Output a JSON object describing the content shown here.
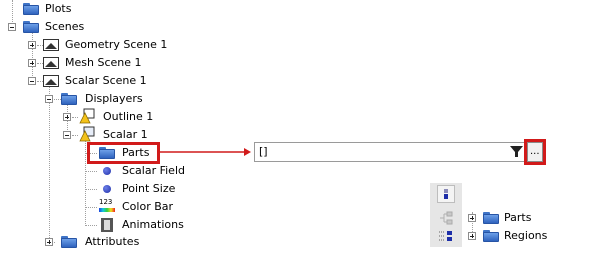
{
  "tree": {
    "plots": "Plots",
    "scenes": "Scenes",
    "geometry_scene": "Geometry Scene 1",
    "mesh_scene": "Mesh Scene 1",
    "scalar_scene": "Scalar Scene 1",
    "displayers": "Displayers",
    "outline": "Outline 1",
    "scalar": "Scalar 1",
    "parts": "Parts",
    "scalar_field": "Scalar Field",
    "point_size": "Point Size",
    "color_bar": "Color Bar",
    "animations": "Animations",
    "attributes": "Attributes",
    "color_bar_icon_text": "123"
  },
  "property_editor": {
    "value": "[]",
    "browse_button_label": "..."
  },
  "parts_selector": {
    "items": [
      "Parts",
      "Regions"
    ]
  },
  "colors": {
    "highlight": "#d11a1a",
    "folder_blue": "#3f74c7"
  }
}
